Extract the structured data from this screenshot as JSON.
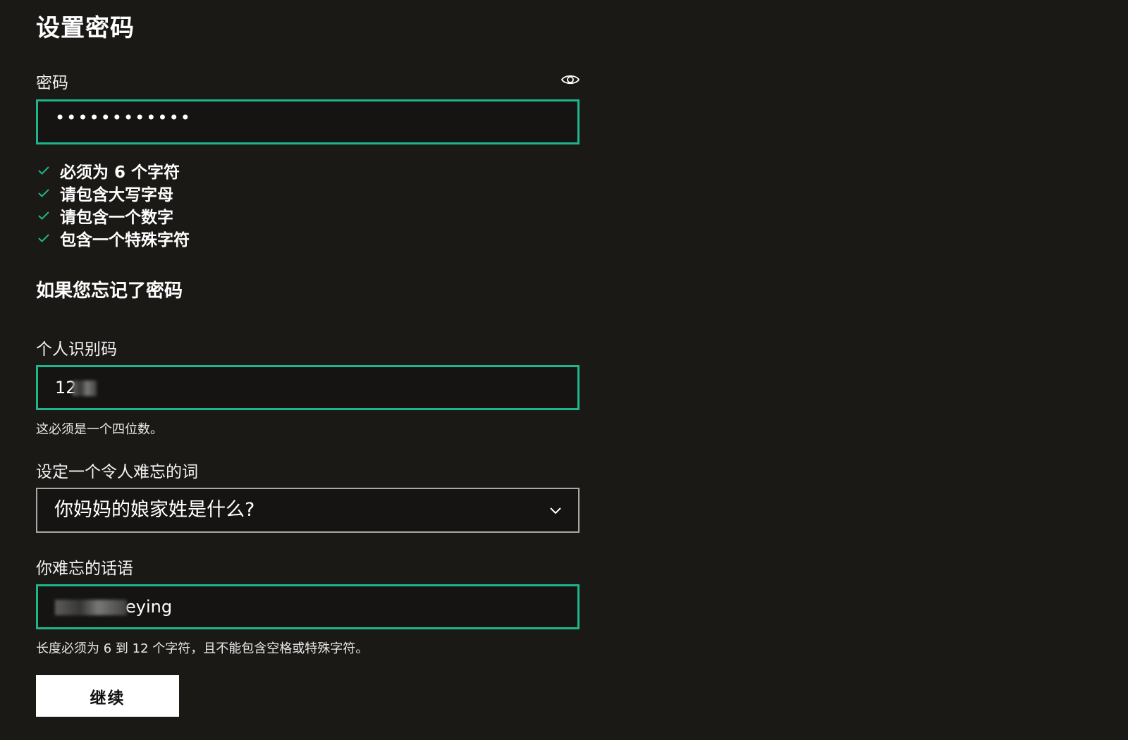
{
  "page_title": "设置密码",
  "password": {
    "label": "密码",
    "masked_value": "••••••••••••",
    "toggle_icon": "eye-icon"
  },
  "requirements": [
    {
      "icon": "check-icon",
      "text": "必须为 6 个字符",
      "met": true
    },
    {
      "icon": "check-icon",
      "text": "请包含大写字母",
      "met": true
    },
    {
      "icon": "check-icon",
      "text": "请包含一个数字",
      "met": true
    },
    {
      "icon": "check-icon",
      "text": "包含一个特殊字符",
      "met": true
    }
  ],
  "recovery_heading": "如果您忘记了密码",
  "pin": {
    "label": "个人识别码",
    "value_visible": "12",
    "hint": "这必须是一个四位数。"
  },
  "memorable_question": {
    "label": "设定一个令人难忘的词",
    "selected": "你妈妈的娘家姓是什么?",
    "icon": "chevron-down-icon"
  },
  "memorable_answer": {
    "label": "你难忘的话语",
    "value_visible": "eying",
    "hint": "长度必须为 6 到 12 个字符，且不能包含空格或特殊字符。"
  },
  "continue_label": "继续",
  "colors": {
    "background": "#1a1916",
    "accent": "#1fb48b",
    "select_border": "#a9a9a9",
    "button_bg": "#ffffff"
  }
}
